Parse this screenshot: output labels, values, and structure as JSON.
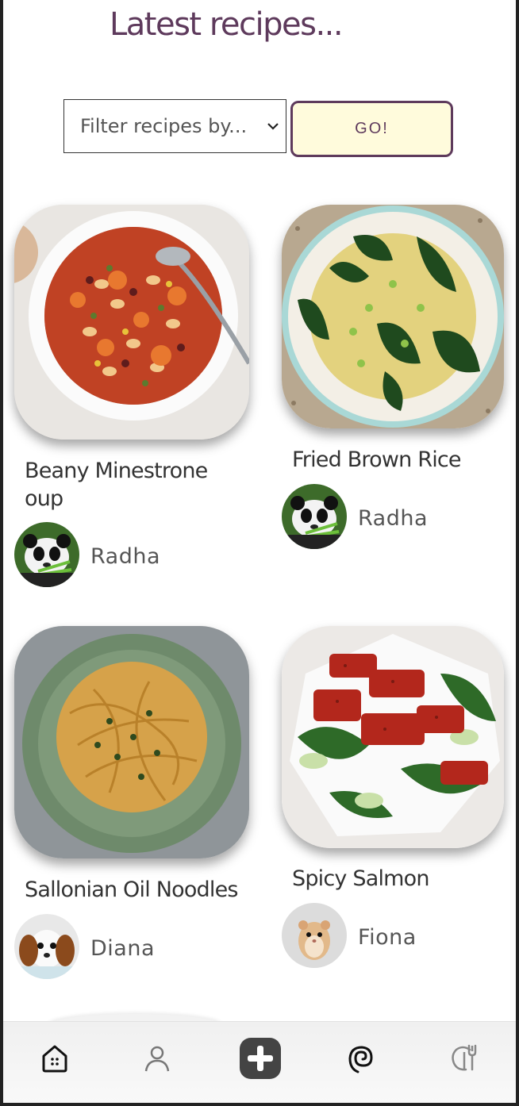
{
  "header": {
    "title": "Latest recipes..."
  },
  "filter": {
    "select_value": "Filter recipes by...",
    "go_label": "GO!"
  },
  "recipes": [
    {
      "name": "Beany Minestrone oup",
      "author": "Radha",
      "author_avatar": "panda"
    },
    {
      "name": "Fried Brown Rice",
      "author": "Radha",
      "author_avatar": "panda"
    },
    {
      "name": "Sallonian Oil Noodles",
      "author": "Diana",
      "author_avatar": "puppy"
    },
    {
      "name": "Spicy Salmon",
      "author": "Fiona",
      "author_avatar": "hamster"
    }
  ],
  "nav": {
    "items": [
      "home-icon",
      "profile-icon",
      "add-icon",
      "spiral-icon",
      "chef-icon"
    ]
  },
  "colors": {
    "accent": "#5e3a5c",
    "go_bg": "#fffbdc"
  }
}
